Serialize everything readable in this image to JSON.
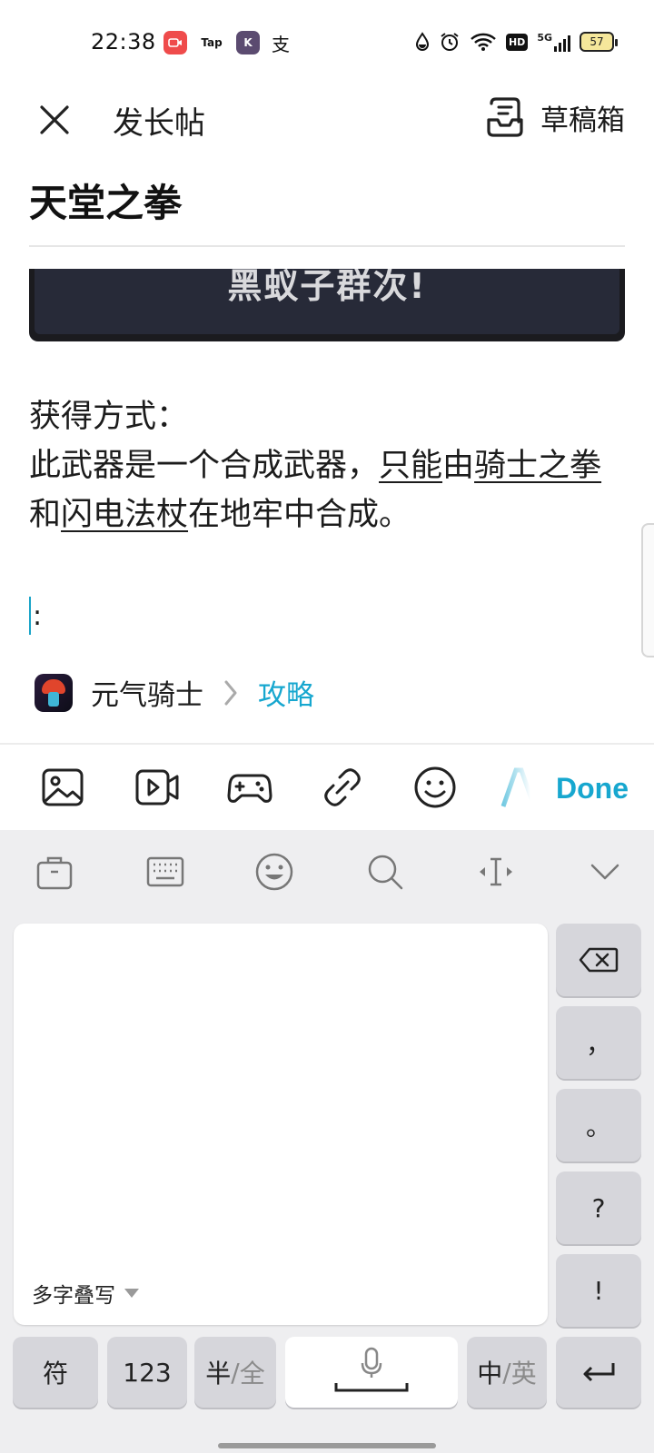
{
  "status_bar": {
    "time": "22:38",
    "apps": [
      {
        "name": "video-app-icon",
        "label": "",
        "color": "#ef4b4b"
      },
      {
        "name": "taptap-icon",
        "label": "Tap",
        "color": "#ffffff"
      },
      {
        "name": "k-app-icon",
        "label": "K",
        "color": "#5b4b70"
      },
      {
        "name": "translate-app-icon",
        "label": "支",
        "color": "#ffffff"
      }
    ],
    "network": "5G",
    "hd": "HD",
    "battery": "57"
  },
  "header": {
    "title": "发长帖",
    "drafts_label": "草稿箱"
  },
  "post": {
    "title": "天堂之拳",
    "image_caption_fragment": "黑蚁子群次!",
    "body": {
      "line1": "获得方式：",
      "line2_prefix": "此武器是一个合成武器，",
      "only": "只能",
      "by": "由",
      "weapon1": "骑士之拳",
      "and": "和",
      "weapon2": "闪电法杖",
      "suffix": "在地牢中合成。"
    },
    "cursor_line": ":"
  },
  "game_tag": {
    "game": "元气骑士",
    "category": "攻略"
  },
  "toolbar": {
    "done_label": "Done",
    "accent": "#17a7cf"
  },
  "keyboard": {
    "handwrite_mode": "多字叠写",
    "keys": {
      "comma": "，",
      "period": "。",
      "question": "?",
      "exclaim": "!",
      "symbol": "符",
      "numbers": "123",
      "half": "半",
      "full": "全",
      "zh": "中",
      "en": "英"
    }
  }
}
